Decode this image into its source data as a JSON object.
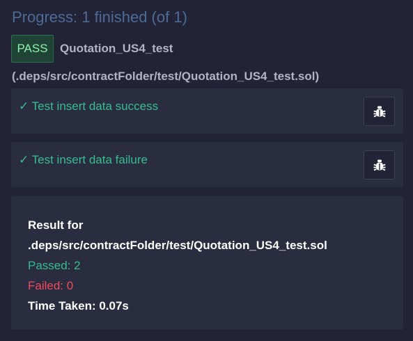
{
  "progress": {
    "title": "Progress: 1 finished (of 1)"
  },
  "test_file": {
    "status": "PASS",
    "name": "Quotation_US4_test",
    "path": "(.deps/src/contractFolder/test/Quotation_US4_test.sol)"
  },
  "tests": [
    {
      "label": "✓ Test insert data success",
      "icon": "bug-icon"
    },
    {
      "label": "✓ Test insert data failure",
      "icon": "bug-icon"
    }
  ],
  "summary": {
    "result_for": "Result for",
    "file": ".deps/src/contractFolder/test/Quotation_US4_test.sol",
    "passed": "Passed: 2",
    "failed": "Failed: 0",
    "time_taken": "Time Taken: 0.07s"
  },
  "colors": {
    "background": "#222336",
    "card": "#2a2c3f",
    "pass_green": "#35bf8e",
    "fail_red": "#ef4b5a",
    "title_blue": "#4d6b95"
  }
}
